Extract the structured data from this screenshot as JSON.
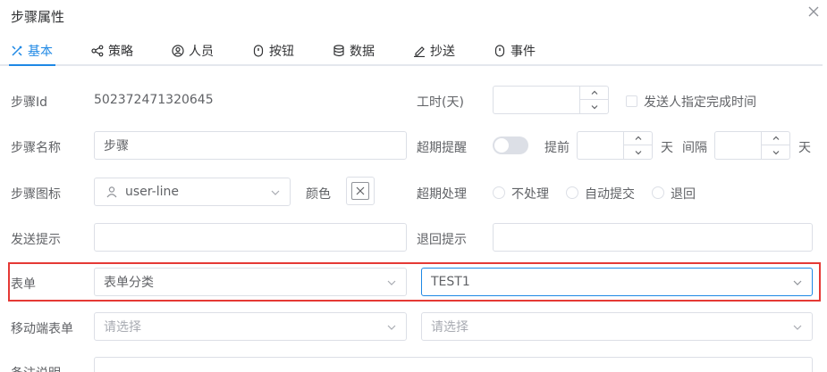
{
  "header": {
    "title": "步骤属性",
    "close_icon": "close-icon"
  },
  "tabs": [
    {
      "label": "基本",
      "icon": "tools-icon",
      "active": true
    },
    {
      "label": "策略",
      "icon": "share-nodes-icon"
    },
    {
      "label": "人员",
      "icon": "user-circle-icon"
    },
    {
      "label": "按钮",
      "icon": "button-icon"
    },
    {
      "label": "数据",
      "icon": "database-icon"
    },
    {
      "label": "抄送",
      "icon": "edit-pen-icon"
    },
    {
      "label": "事件",
      "icon": "event-icon"
    }
  ],
  "form": {
    "step_id": {
      "label": "步骤Id",
      "value": "502372471320645"
    },
    "step_name": {
      "label": "步骤名称",
      "value": "步骤"
    },
    "step_icon": {
      "label": "步骤图标",
      "value": "user-line",
      "icon": "user-icon"
    },
    "color": {
      "label": "颜色"
    },
    "send_hint": {
      "label": "发送提示",
      "value": ""
    },
    "form_field": {
      "label": "表单",
      "category_value": "表单分类",
      "form_value": "TEST1"
    },
    "mobile_form": {
      "label": "移动端表单",
      "placeholder_left": "请选择",
      "placeholder_right": "请选择"
    },
    "remark": {
      "label": "备注说明"
    },
    "work_hours": {
      "label": "工时(天)",
      "value": ""
    },
    "sender_assign": {
      "label": "发送人指定完成时间"
    },
    "overdue_remind": {
      "label": "超期提醒",
      "before_label": "提前",
      "day_unit_1": "天",
      "interval_label": "间隔",
      "day_unit_2": "天"
    },
    "overdue_handle": {
      "label": "超期处理",
      "options": [
        "不处理",
        "自动提交",
        "退回"
      ]
    },
    "return_hint": {
      "label": "退回提示",
      "value": ""
    }
  },
  "colors": {
    "accent": "#1e88e5",
    "highlight": "#e53935",
    "border": "#dcdfe6"
  }
}
